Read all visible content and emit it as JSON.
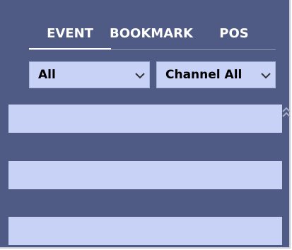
{
  "tabs": [
    {
      "label": "EVENT"
    },
    {
      "label": "BOOKMARK"
    },
    {
      "label": "POS"
    }
  ],
  "filters": {
    "category": {
      "value": "All"
    },
    "channel": {
      "value": "Channel All"
    }
  },
  "icons": {
    "dropdown": "chevron-down-icon",
    "scroll": "double-chevron-up-icon"
  },
  "colors": {
    "panel_bg": "#4f5a85",
    "row_bg": "#c8d2f7",
    "text_light": "#ffffff"
  },
  "list": {
    "rows": [
      {},
      {},
      {}
    ]
  }
}
